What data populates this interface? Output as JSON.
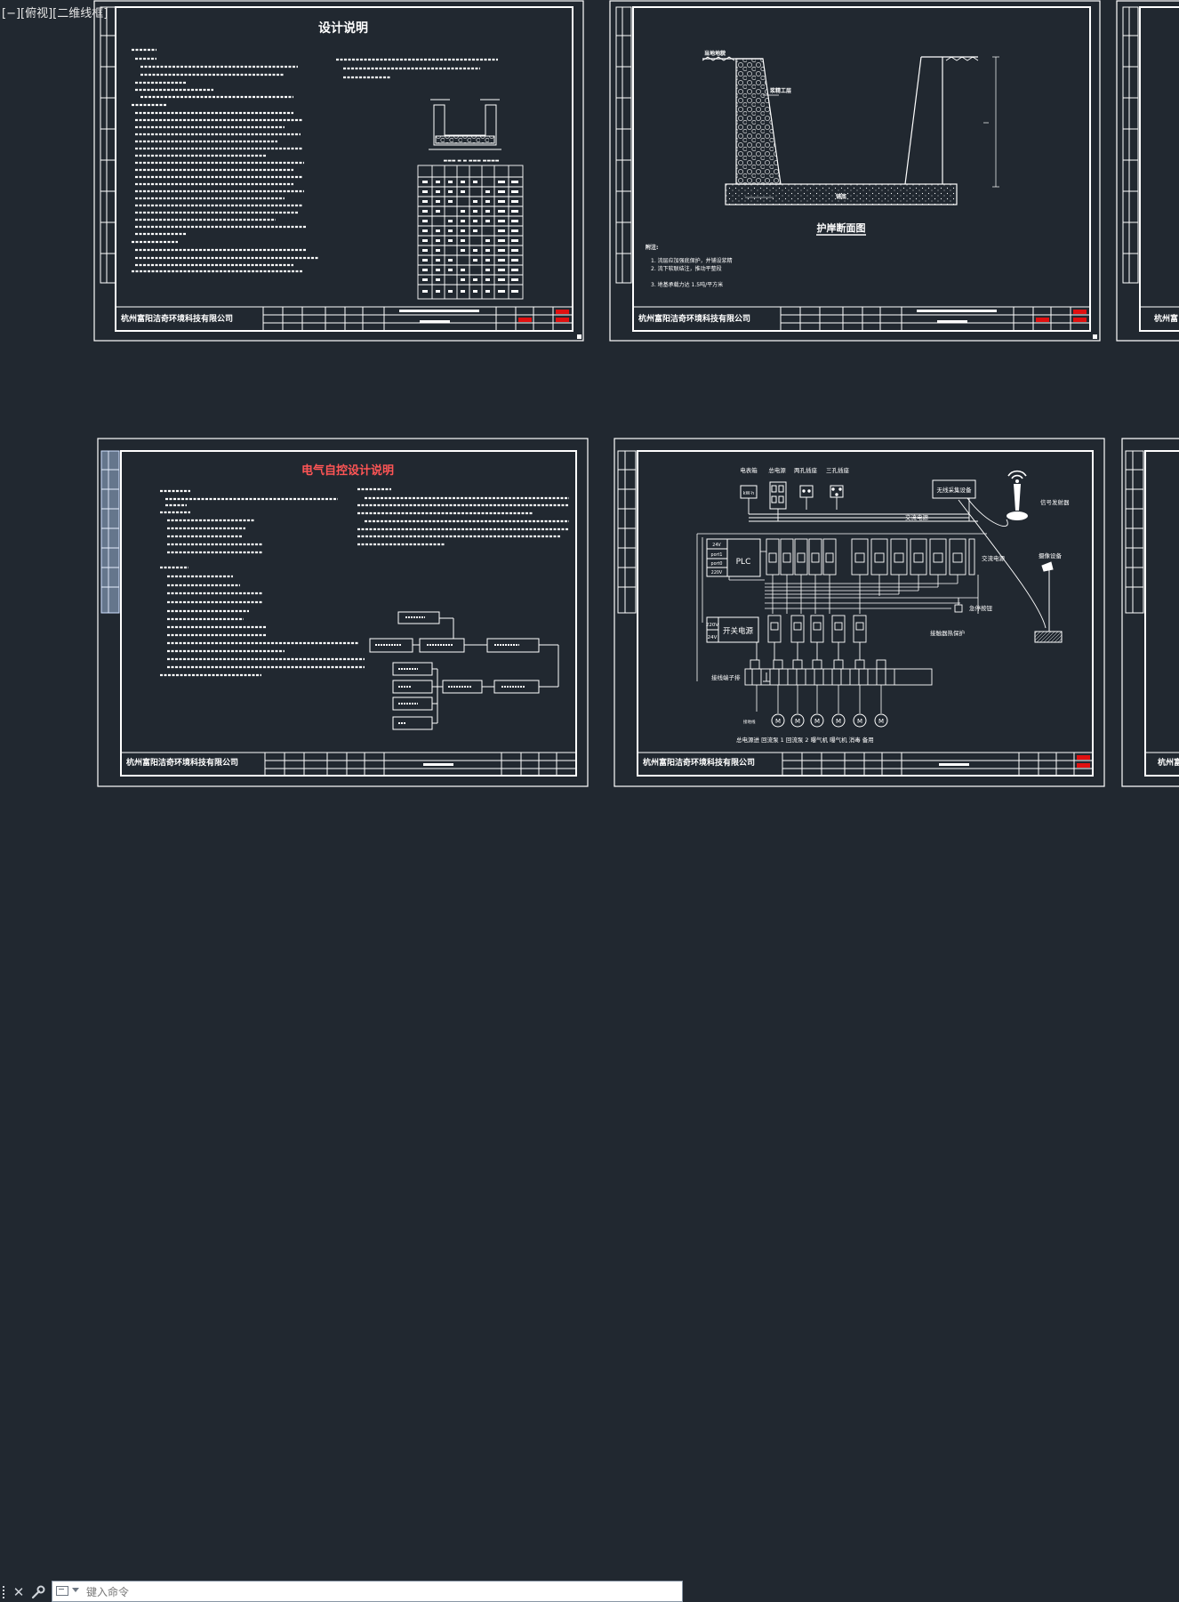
{
  "viewport": {
    "label": "[−][俯视][二维线框]"
  },
  "sheets": {
    "design_notes": {
      "title": "设计说明"
    },
    "bank_section": {
      "title": "护岸断面图",
      "label_top_left": "当地地貌",
      "label_side": "浆精工层",
      "label_bottom": "铺底",
      "notes_head": "附注:",
      "notes": [
        "1. 流层应加强底保护，并铺设浆精",
        "2. 流下软联结注，推动平整段",
        "3. 地基承载力达 1.5吨/平方米"
      ]
    },
    "electrical_notes": {
      "title": "电气自控设计说明"
    },
    "wiring": {
      "top_labels": [
        "电表箱",
        "总电源",
        "两孔插座",
        "三孔插座"
      ],
      "meter_text": "kW·h",
      "ac_bus_1": "交流电源",
      "ac_bus_2": "交流电源",
      "wireless_box": "无线采集设备",
      "antenna_label": "信号发射器",
      "camera_label": "摄像设备",
      "plc_label": "PLC",
      "plc_pins": [
        "24V",
        "port1",
        "port0",
        "220V"
      ],
      "psu_label": "开关电源",
      "psu_volts": [
        "220V",
        "24V"
      ],
      "estop": "急停按钮",
      "thermal": "接触器热保护",
      "terminal_block": "接线端子排",
      "motor_symbol": "M",
      "ground_label": "接地线",
      "bottom_labels": "总电源进 回流泵 1 回流泵 2 曝气机 曝气机 消毒 备用"
    },
    "company_name": "杭州富阳洁奇环境科技有限公司",
    "company_name_short": "杭州富"
  },
  "commandline": {
    "placeholder": "键入命令"
  },
  "colors": {
    "background": "#212830",
    "line": "#ffffff",
    "title_red": "#ff5555",
    "stamp_red": "#e01010",
    "side_strip": "#9fb6d8"
  }
}
